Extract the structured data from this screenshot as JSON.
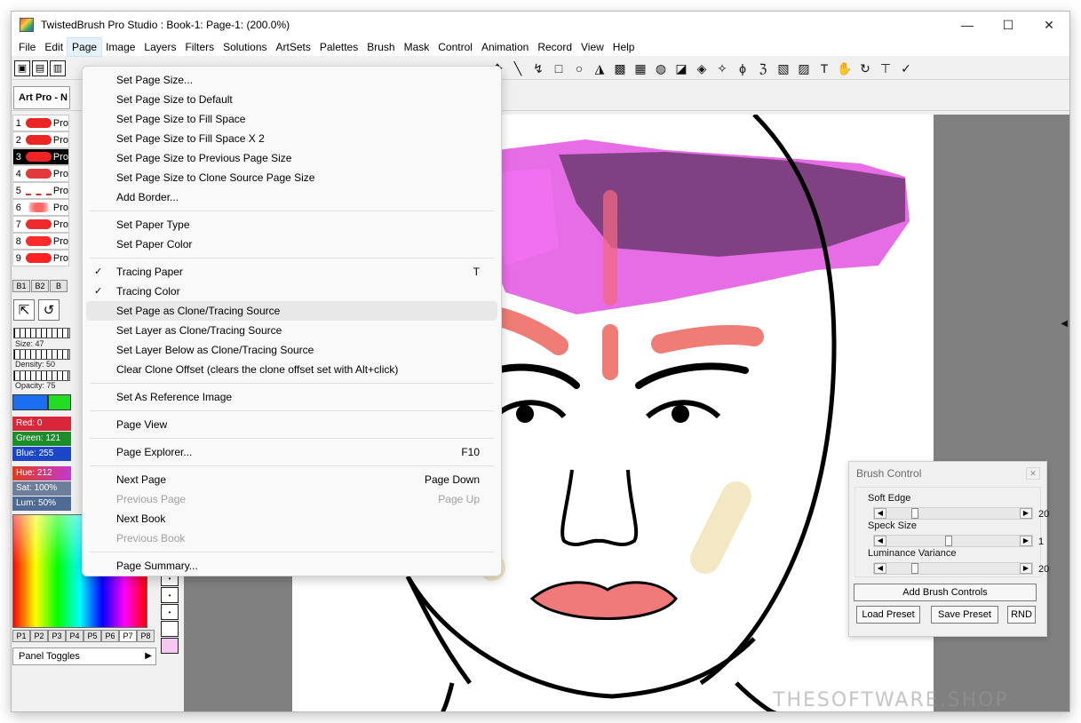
{
  "window": {
    "title": "TwistedBrush Pro Studio : Book-1: Page-1:  (200.0%)",
    "controls": {
      "minimize": "—",
      "maximize": "☐",
      "close": "✕"
    }
  },
  "menubar": {
    "items": [
      "File",
      "Edit",
      "Page",
      "Image",
      "Layers",
      "Filters",
      "Solutions",
      "ArtSets",
      "Palettes",
      "Brush",
      "Mask",
      "Control",
      "Animation",
      "Record",
      "View",
      "Help"
    ],
    "active": "Page"
  },
  "preset": {
    "label": "Art Pro - N"
  },
  "brushes": {
    "items": [
      {
        "num": "1",
        "label": "Pro"
      },
      {
        "num": "2",
        "label": "Pro"
      },
      {
        "num": "3",
        "label": "Pro"
      },
      {
        "num": "4",
        "label": "Pro"
      },
      {
        "num": "5",
        "label": "Pro"
      },
      {
        "num": "6",
        "label": "Pro"
      },
      {
        "num": "7",
        "label": "Pro"
      },
      {
        "num": "8",
        "label": "Pro"
      },
      {
        "num": "9",
        "label": "Pro"
      }
    ],
    "selected_index": 2,
    "banks": [
      "B1",
      "B2",
      "B"
    ]
  },
  "sliders": {
    "size": "Size: 47",
    "density": "Density: 50",
    "opacity": "Opacity: 75"
  },
  "colors": {
    "primary": "#1a6ef0",
    "secondary": "#22dd22",
    "red": "Red: 0",
    "green": "Green: 121",
    "blue": "Blue: 255",
    "hue": "Hue: 212",
    "sat": "Sat: 100%",
    "lum": "Lum: 50%"
  },
  "palettes": {
    "tabs": [
      "P1",
      "P2",
      "P3",
      "P4",
      "P5",
      "P6",
      "P7",
      "P8"
    ],
    "active": "P7"
  },
  "panel_toggles": {
    "label": "Panel Toggles"
  },
  "page_menu": {
    "groups": [
      [
        {
          "label": "Set Page Size..."
        },
        {
          "label": "Set Page Size to Default"
        },
        {
          "label": "Set Page Size to Fill Space"
        },
        {
          "label": "Set Page Size to Fill Space X 2"
        },
        {
          "label": "Set Page Size to Previous Page Size"
        },
        {
          "label": "Set Page Size to Clone Source Page Size"
        },
        {
          "label": "Add Border..."
        }
      ],
      [
        {
          "label": "Set Paper Type"
        },
        {
          "label": "Set Paper Color"
        }
      ],
      [
        {
          "label": "Tracing Paper",
          "shortcut": "T",
          "checked": true
        },
        {
          "label": "Tracing Color",
          "checked": true
        },
        {
          "label": "Set Page as Clone/Tracing Source",
          "hover": true
        },
        {
          "label": "Set Layer as Clone/Tracing Source"
        },
        {
          "label": "Set Layer Below as Clone/Tracing Source"
        },
        {
          "label": "Clear Clone Offset (clears the clone offset set with Alt+click)"
        }
      ],
      [
        {
          "label": "Set As Reference Image"
        }
      ],
      [
        {
          "label": "Page View"
        }
      ],
      [
        {
          "label": "Page Explorer...",
          "shortcut": "F10"
        }
      ],
      [
        {
          "label": "Next Page",
          "shortcut": "Page Down"
        },
        {
          "label": "Previous Page",
          "shortcut": "Page Up",
          "disabled": true
        },
        {
          "label": "Next Book"
        },
        {
          "label": "Previous Book",
          "disabled": true
        }
      ],
      [
        {
          "label": "Page Summary..."
        }
      ]
    ]
  },
  "brush_control": {
    "title": "Brush Control",
    "soft_edge": {
      "label": "Soft Edge",
      "value": "20"
    },
    "speck_size": {
      "label": "Speck Size",
      "value": "1"
    },
    "luminance_variance": {
      "label": "Luminance Variance",
      "value": "20"
    },
    "add_label": "Add Brush Controls",
    "load_label": "Load Preset",
    "save_label": "Save Preset",
    "rnd_label": "RND"
  },
  "watermark": "THESOFTWARE.SHOP"
}
